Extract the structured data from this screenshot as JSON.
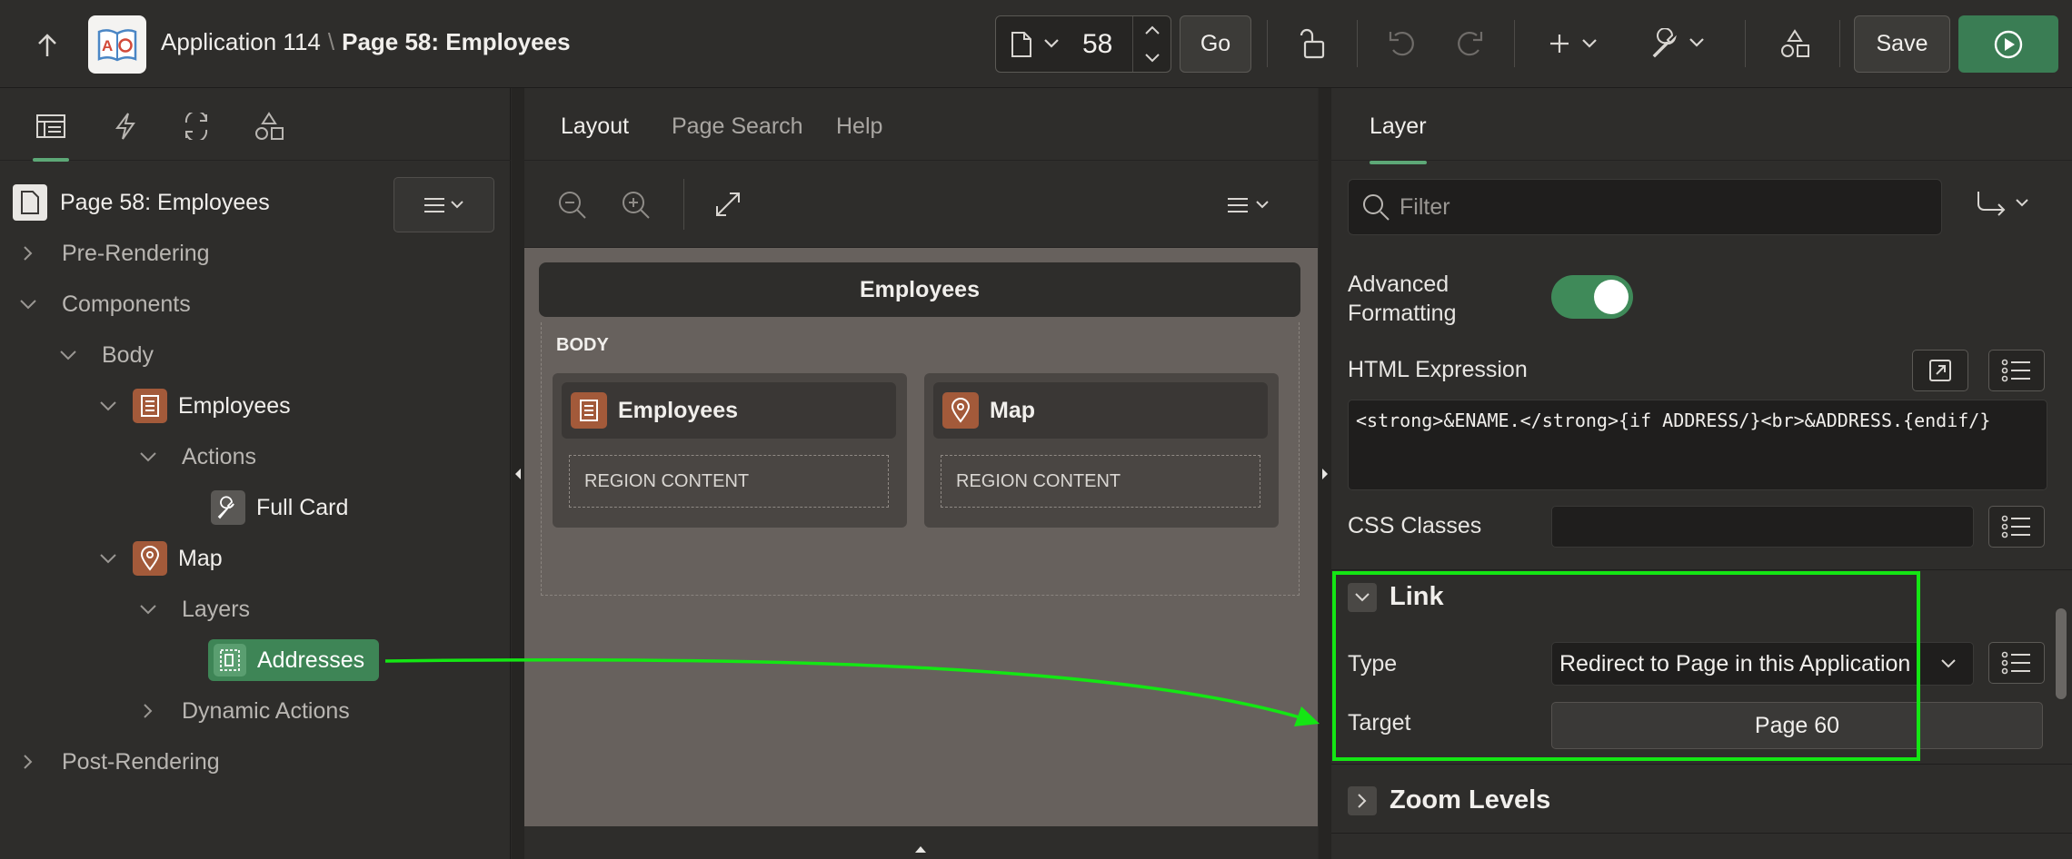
{
  "header": {
    "app_name": "Application 114",
    "separator": "\\",
    "page_title": "Page 58: Employees",
    "page_number": "58",
    "go_label": "Go",
    "save_label": "Save"
  },
  "left": {
    "menu_icon": "hamburger-icon",
    "tree": {
      "root": "Page 58: Employees",
      "pre_rendering": "Pre-Rendering",
      "components": "Components",
      "body": "Body",
      "employees": "Employees",
      "actions": "Actions",
      "full_card": "Full Card",
      "map": "Map",
      "layers": "Layers",
      "addresses": "Addresses",
      "dynamic_actions": "Dynamic Actions",
      "post_rendering": "Post-Rendering"
    }
  },
  "center": {
    "tabs": [
      "Layout",
      "Page Search",
      "Help"
    ],
    "region_title": "Employees",
    "body_label": "BODY",
    "regions": [
      {
        "title": "Employees",
        "content": "REGION CONTENT"
      },
      {
        "title": "Map",
        "content": "REGION CONTENT"
      }
    ]
  },
  "right": {
    "tab": "Layer",
    "filter_placeholder": "Filter",
    "advanced_formatting_label": "Advanced Formatting",
    "advanced_formatting_on": true,
    "html_expression_label": "HTML Expression",
    "html_expression_value": "<strong>&ENAME.</strong>{if ADDRESS/}<br>&ADDRESS.{endif/}",
    "css_classes_label": "CSS Classes",
    "link_section": "Link",
    "type_label": "Type",
    "type_value": "Redirect to Page in this Application",
    "target_label": "Target",
    "target_value": "Page 60",
    "zoom_section": "Zoom Levels"
  },
  "colors": {
    "accent_green": "#3e8556",
    "highlight": "#14e614",
    "region_icon": "#a35a3a"
  }
}
